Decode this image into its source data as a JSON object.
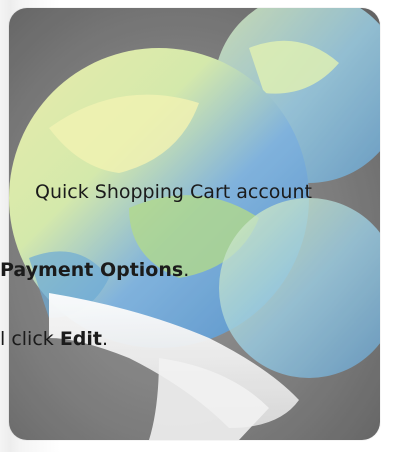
{
  "content": {
    "line1": "Quick Shopping Cart account",
    "line2_bold": "Payment Options",
    "line2_tail": ".",
    "line3_pre": "l click ",
    "line3_bold": "Edit",
    "line3_tail": "."
  },
  "icon": {
    "name": "network-globe-icon",
    "colors": {
      "frame": "#6f6f6f",
      "globe_blue": "#4c90c8",
      "globe_yellow": "#e8e48e",
      "globe_green": "#9fcf7a",
      "cable_white": "#f3f3f3"
    }
  }
}
